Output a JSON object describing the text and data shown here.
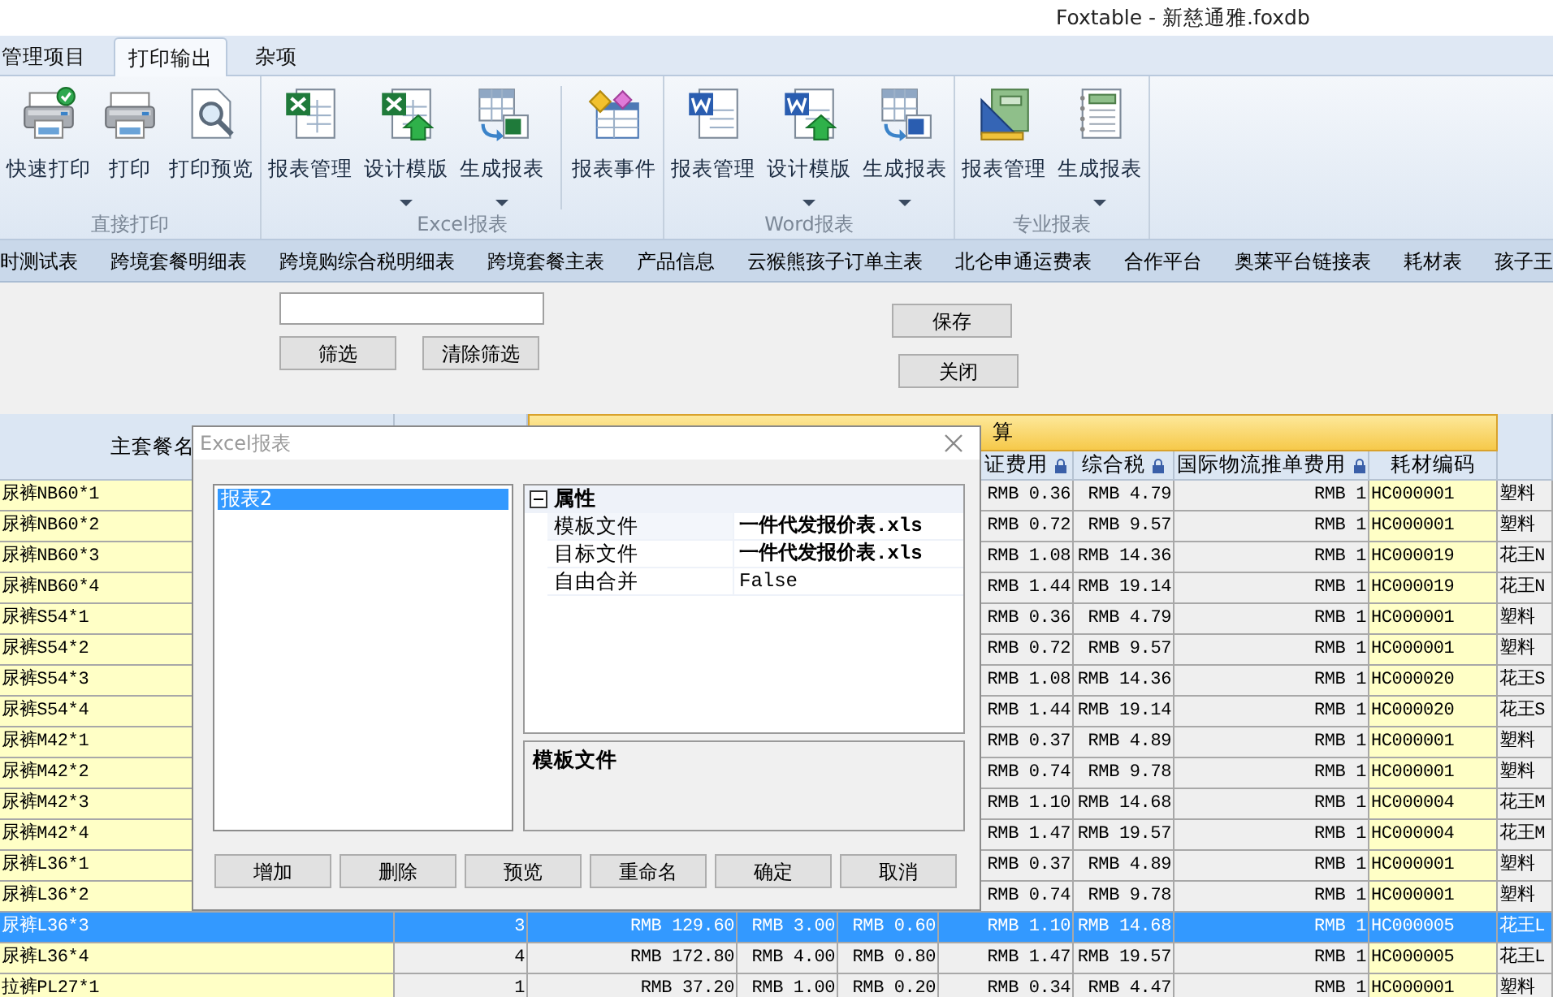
{
  "window": {
    "title": "Foxtable - 新慈通雅.foxdb"
  },
  "ribbon": {
    "tabs": [
      {
        "label": "管理项目",
        "selected": false
      },
      {
        "label": "打印输出",
        "selected": true
      },
      {
        "label": "杂项",
        "selected": false
      }
    ],
    "groups": [
      {
        "label": "直接打印",
        "items": [
          {
            "label": "快速打印",
            "dropdown": false
          },
          {
            "label": "打印",
            "dropdown": false
          },
          {
            "label": "打印预览",
            "dropdown": false
          }
        ]
      },
      {
        "label": "Excel报表",
        "items": [
          {
            "label": "报表管理",
            "dropdown": false
          },
          {
            "label": "设计模版",
            "dropdown": true
          },
          {
            "label": "生成报表",
            "dropdown": true
          },
          {
            "label": "报表事件",
            "dropdown": false,
            "divider_before": true
          }
        ]
      },
      {
        "label": "Word报表",
        "items": [
          {
            "label": "报表管理",
            "dropdown": false
          },
          {
            "label": "设计模版",
            "dropdown": true
          },
          {
            "label": "生成报表",
            "dropdown": true
          }
        ]
      },
      {
        "label": "专业报表",
        "items": [
          {
            "label": "报表管理",
            "dropdown": false
          },
          {
            "label": "生成报表",
            "dropdown": true
          }
        ]
      }
    ]
  },
  "sheet_tabs": [
    "时测试表",
    "跨境套餐明细表",
    "跨境购综合税明细表",
    "跨境套餐主表",
    "产品信息",
    "云猴熊孩子订单主表",
    "北仑申通运费表",
    "合作平台",
    "奥莱平台链接表",
    "耗材表",
    "孩子王"
  ],
  "filter_form": {
    "buttons": [
      "筛选",
      "清除筛选"
    ],
    "side_buttons": [
      "保存",
      "关闭"
    ]
  },
  "grid": {
    "group_header": "算",
    "columns": [
      {
        "label": "主套餐名"
      },
      {},
      {},
      {},
      {},
      {
        "label": "证费用",
        "locked": true
      },
      {
        "label": "综合税",
        "locked": true
      },
      {
        "label": "国际物流推单费用",
        "locked": true
      },
      {
        "label": "耗材编码",
        "locked": false
      },
      {}
    ],
    "rows": [
      {
        "selected": false,
        "cells": [
          "尿裤NB60*1",
          null,
          null,
          null,
          null,
          "RMB 0.36",
          "RMB 4.79",
          "RMB 1",
          "HC000001",
          "塑料"
        ]
      },
      {
        "selected": false,
        "cells": [
          "尿裤NB60*2",
          null,
          null,
          null,
          null,
          "RMB 0.72",
          "RMB 9.57",
          "RMB 1",
          "HC000001",
          "塑料"
        ]
      },
      {
        "selected": false,
        "cells": [
          "尿裤NB60*3",
          null,
          null,
          null,
          null,
          "RMB 1.08",
          "RMB 14.36",
          "RMB 1",
          "HC000019",
          "花王N"
        ]
      },
      {
        "selected": false,
        "cells": [
          "尿裤NB60*4",
          null,
          null,
          null,
          null,
          "RMB 1.44",
          "RMB 19.14",
          "RMB 1",
          "HC000019",
          "花王N"
        ]
      },
      {
        "selected": false,
        "cells": [
          "尿裤S54*1",
          null,
          null,
          null,
          null,
          "RMB 0.36",
          "RMB 4.79",
          "RMB 1",
          "HC000001",
          "塑料"
        ]
      },
      {
        "selected": false,
        "cells": [
          "尿裤S54*2",
          null,
          null,
          null,
          null,
          "RMB 0.72",
          "RMB 9.57",
          "RMB 1",
          "HC000001",
          "塑料"
        ]
      },
      {
        "selected": false,
        "cells": [
          "尿裤S54*3",
          null,
          null,
          null,
          null,
          "RMB 1.08",
          "RMB 14.36",
          "RMB 1",
          "HC000020",
          "花王S"
        ]
      },
      {
        "selected": false,
        "cells": [
          "尿裤S54*4",
          null,
          null,
          null,
          null,
          "RMB 1.44",
          "RMB 19.14",
          "RMB 1",
          "HC000020",
          "花王S"
        ]
      },
      {
        "selected": false,
        "cells": [
          "尿裤M42*1",
          null,
          null,
          null,
          null,
          "RMB 0.37",
          "RMB 4.89",
          "RMB 1",
          "HC000001",
          "塑料"
        ]
      },
      {
        "selected": false,
        "cells": [
          "尿裤M42*2",
          null,
          null,
          null,
          null,
          "RMB 0.74",
          "RMB 9.78",
          "RMB 1",
          "HC000001",
          "塑料"
        ]
      },
      {
        "selected": false,
        "cells": [
          "尿裤M42*3",
          null,
          null,
          null,
          null,
          "RMB 1.10",
          "RMB 14.68",
          "RMB 1",
          "HC000004",
          "花王M"
        ]
      },
      {
        "selected": false,
        "cells": [
          "尿裤M42*4",
          null,
          null,
          null,
          null,
          "RMB 1.47",
          "RMB 19.57",
          "RMB 1",
          "HC000004",
          "花王M"
        ]
      },
      {
        "selected": false,
        "cells": [
          "尿裤L36*1",
          null,
          null,
          null,
          null,
          "RMB 0.37",
          "RMB 4.89",
          "RMB 1",
          "HC000001",
          "塑料"
        ]
      },
      {
        "selected": false,
        "cells": [
          "尿裤L36*2",
          null,
          null,
          null,
          null,
          "RMB 0.74",
          "RMB 9.78",
          "RMB 1",
          "HC000001",
          "塑料"
        ]
      },
      {
        "selected": true,
        "cells": [
          "尿裤L36*3",
          "3",
          "RMB 129.60",
          "RMB 3.00",
          "RMB 0.60",
          "RMB 1.10",
          "RMB 14.68",
          "RMB 1",
          "HC000005",
          "花王L"
        ]
      },
      {
        "selected": false,
        "cells": [
          "尿裤L36*4",
          "4",
          "RMB 172.80",
          "RMB 4.00",
          "RMB 0.80",
          "RMB 1.47",
          "RMB 19.57",
          "RMB 1",
          "HC000005",
          "花王L"
        ]
      },
      {
        "selected": false,
        "cells": [
          "拉裤PL27*1",
          "1",
          "RMB 37.20",
          "RMB 1.00",
          "RMB 0.20",
          "RMB 0.34",
          "RMB 4.47",
          "RMB 1",
          "HC000001",
          "塑料"
        ]
      }
    ]
  },
  "dialog": {
    "title": "Excel报表",
    "reports": [
      {
        "label": "报表2",
        "selected": true
      }
    ],
    "properties": {
      "category": "属性",
      "expanded": true,
      "rows": [
        {
          "name": "模板文件",
          "value": "一件代发报价表.xls",
          "bold": true,
          "selected": true
        },
        {
          "name": "目标文件",
          "value": "一件代发报价表.xls",
          "bold": true,
          "selected": false
        },
        {
          "name": "自由合并",
          "value": "False",
          "bold": false,
          "selected": false
        }
      ]
    },
    "description": "模板文件",
    "buttons": [
      "增加",
      "删除",
      "预览",
      "重命名",
      "确定",
      "取消"
    ]
  }
}
